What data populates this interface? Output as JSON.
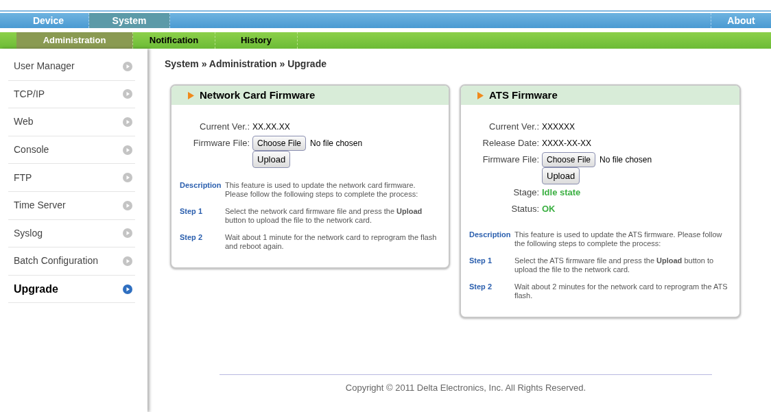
{
  "top_nav": {
    "items": [
      {
        "label": "Device",
        "selected": false
      },
      {
        "label": "System",
        "selected": true
      }
    ],
    "about": "About"
  },
  "sub_nav": [
    {
      "label": "Administration",
      "selected": true
    },
    {
      "label": "Notification",
      "selected": false
    },
    {
      "label": "History",
      "selected": false
    }
  ],
  "sidebar": {
    "items": [
      {
        "label": "User Manager",
        "selected": false
      },
      {
        "label": "TCP/IP",
        "selected": false
      },
      {
        "label": "Web",
        "selected": false
      },
      {
        "label": "Console",
        "selected": false
      },
      {
        "label": "FTP",
        "selected": false
      },
      {
        "label": "Time Server",
        "selected": false
      },
      {
        "label": "Syslog",
        "selected": false
      },
      {
        "label": "Batch Configuration",
        "selected": false
      },
      {
        "label": "Upgrade",
        "selected": true
      }
    ]
  },
  "breadcrumb": "System » Administration » Upgrade",
  "panels": [
    {
      "title": "Network Card Firmware",
      "fields": [
        {
          "kind": "text",
          "label": "Current Ver.:",
          "value": "XX.XX.XX"
        },
        {
          "kind": "file",
          "label": "Firmware File:",
          "button": "Choose File",
          "value": "No file chosen"
        },
        {
          "kind": "button",
          "button": "Upload"
        }
      ],
      "description_label": "Description",
      "description": "This feature is used to update the network card firmware. Please follow the following steps to complete the process:",
      "steps": [
        {
          "label": "Step 1",
          "text": "Select the network card firmware file and press the **Upload** button to upload the file to the network card."
        },
        {
          "label": "Step 2",
          "text": "Wait about 1 minute for the network card to reprogram the flash and reboot again."
        }
      ]
    },
    {
      "title": "ATS Firmware",
      "fields": [
        {
          "kind": "text",
          "label": "Current Ver.:",
          "value": "XXXXXX"
        },
        {
          "kind": "text",
          "label": "Release Date:",
          "value": "XXXX-XX-XX"
        },
        {
          "kind": "file",
          "label": "Firmware File:",
          "button": "Choose File",
          "value": "No file chosen"
        },
        {
          "kind": "button",
          "button": "Upload"
        },
        {
          "kind": "status",
          "label": "Stage:",
          "value": "Idle state"
        },
        {
          "kind": "status",
          "label": "Status:",
          "value": "OK"
        }
      ],
      "description_label": "Description",
      "description": "This feature is used to update the ATS firmware. Please follow the following steps to complete the process:",
      "steps": [
        {
          "label": "Step 1",
          "text": "Select the ATS firmware file and press the **Upload** button to upload the file to the network card."
        },
        {
          "label": "Step 2",
          "text": "Wait about 2 minutes for the network card to reprogram the ATS flash."
        }
      ]
    }
  ],
  "footer": "Copyright © 2011 Delta Electronics, Inc. All Rights Reserved."
}
